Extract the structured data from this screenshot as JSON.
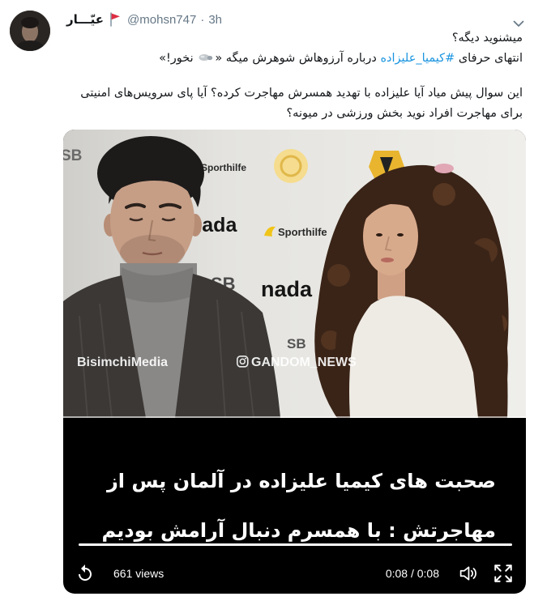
{
  "colors": {
    "text": "#14171a",
    "secondary": "#657786",
    "link": "#1b95e0",
    "flag": "#dd2e44"
  },
  "icons": {
    "menu": "chevron-down-icon",
    "badge": "red-flag-icon",
    "inline_emoji": "emoji-icon",
    "replay": "replay-icon",
    "volume": "volume-icon",
    "fullscreen": "fullscreen-icon",
    "watermark": "instagram-icon"
  },
  "tweet": {
    "author": {
      "display_name": "عیّـــار",
      "handle": "@mohsn747"
    },
    "separator": "·",
    "time": "3h",
    "text": {
      "line1": "میشنوید دیگه؟",
      "line2_before_hashtag": "انتهای حرفای ",
      "hashtag": "#کیمیا_علیزاده",
      "line2_after_hashtag": " درباره آرزوهاش شوهرش میگه «",
      "line2_end": " نخور!»",
      "paragraph2": "این سوال پیش میاد آیا علیزاده با تهدید همسرش مهاجرت کرده؟ آیا پای سرویس‌های امنیتی برای مهاجرت افراد نوید بخش ورزشی در میونه؟"
    }
  },
  "video": {
    "backdrop_logos": [
      "SB",
      "Sporthilfe",
      "nada",
      "Sporthilfe",
      "SB",
      "nada",
      "SB"
    ],
    "watermarks": [
      "BisimchiMedia",
      "GANDOM_NEWS"
    ],
    "subtitles": [
      "صحبت های کیمیا علیزاده در آلمان پس از",
      "مهاجرتش : با همسرم دنبال آرامش بودیم"
    ],
    "progress": 1,
    "views": "661 views",
    "time_display": "0:08 / 0:08"
  }
}
